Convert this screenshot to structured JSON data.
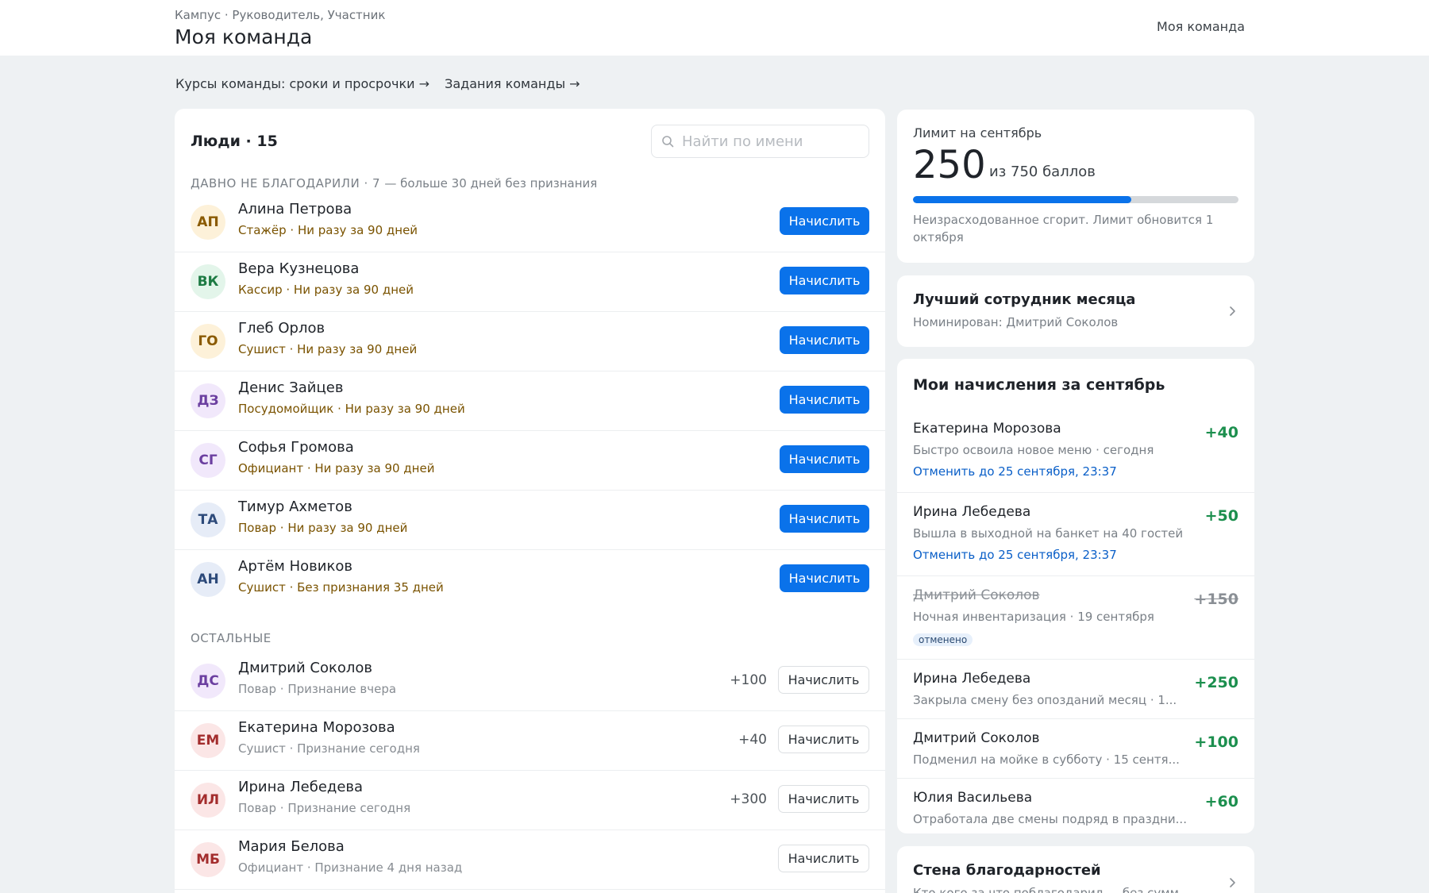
{
  "header": {
    "breadcrumb": "Кампус · Руководитель, Участник",
    "title": "Моя команда",
    "right_link": "Моя команда"
  },
  "links": [
    "Курсы команды: сроки и просрочки →",
    "Задания команды →"
  ],
  "people": {
    "heading": "Люди · 15",
    "search_placeholder": "Найти по имени",
    "stale_section": {
      "title": "ДАВНО НЕ БЛАГОДАРИЛИ · 7",
      "subtitle": "— больше 30 дней без признания"
    },
    "other_section_title": "ОСТАЛЬНЫЕ",
    "stale": [
      {
        "initials": "АП",
        "name": "Алина Петрова",
        "meta": "Стажёр · Ни разу за 90 дней",
        "action": "Начислить",
        "avatar_bg": "#fdf1d9",
        "avatar_fg": "#8a5a00"
      },
      {
        "initials": "ВК",
        "name": "Вера Кузнецова",
        "meta": "Кассир · Ни разу за 90 дней",
        "action": "Начислить",
        "avatar_bg": "#e3f5ea",
        "avatar_fg": "#1d7a43"
      },
      {
        "initials": "ГО",
        "name": "Глеб Орлов",
        "meta": "Сушист · Ни разу за 90 дней",
        "action": "Начислить",
        "avatar_bg": "#fdf1d9",
        "avatar_fg": "#8a5a00"
      },
      {
        "initials": "ДЗ",
        "name": "Денис Зайцев",
        "meta": "Посудомойщик · Ни разу за 90 дней",
        "action": "Начислить",
        "avatar_bg": "#f1e8fb",
        "avatar_fg": "#6b3fa0"
      },
      {
        "initials": "СГ",
        "name": "Софья Громова",
        "meta": "Официант · Ни разу за 90 дней",
        "action": "Начислить",
        "avatar_bg": "#f1e8fb",
        "avatar_fg": "#6b3fa0"
      },
      {
        "initials": "ТА",
        "name": "Тимур Ахметов",
        "meta": "Повар · Ни разу за 90 дней",
        "action": "Начислить",
        "avatar_bg": "#e6ecf7",
        "avatar_fg": "#2d4a7a"
      },
      {
        "initials": "АН",
        "name": "Артём Новиков",
        "meta": "Сушист · Без признания 35 дней",
        "action": "Начислить",
        "avatar_bg": "#e6ecf7",
        "avatar_fg": "#2d4a7a"
      }
    ],
    "others": [
      {
        "initials": "ДС",
        "name": "Дмитрий Соколов",
        "meta": "Повар · Признание вчера",
        "points": "+100",
        "action": "Начислить",
        "avatar_bg": "#f1e8fb",
        "avatar_fg": "#6b3fa0"
      },
      {
        "initials": "ЕМ",
        "name": "Екатерина Морозова",
        "meta": "Сушист · Признание сегодня",
        "points": "+40",
        "action": "Начислить",
        "avatar_bg": "#fbe6e6",
        "avatar_fg": "#a32d2d"
      },
      {
        "initials": "ИЛ",
        "name": "Ирина Лебедева",
        "meta": "Повар · Признание сегодня",
        "points": "+300",
        "action": "Начислить",
        "avatar_bg": "#fbe6e6",
        "avatar_fg": "#a32d2d"
      },
      {
        "initials": "МБ",
        "name": "Мария Белова",
        "meta": "Официант · Признание 4 дня назад",
        "points": "",
        "action": "Начислить",
        "avatar_bg": "#fbe6e6",
        "avatar_fg": "#a32d2d"
      }
    ]
  },
  "limit": {
    "label": "Лимит на сентябрь",
    "value": "250",
    "of_text": "из 750 баллов",
    "progress_fraction": 0.67,
    "note": "Неизрасходованное сгорит. Лимит обновится 1 октября"
  },
  "best_employee": {
    "title": "Лучший сотрудник месяца",
    "subtitle": "Номинирован: Дмитрий Соколов"
  },
  "my_grants": {
    "title": "Мои начисления за сентябрь",
    "items": [
      {
        "name": "Екатерина Морозова",
        "amount": "+40",
        "desc": "Быстро освоила новое меню · сегодня",
        "cancel": "Отменить до 25 сентября, 23:37",
        "cancelled": false
      },
      {
        "name": "Ирина Лебедева",
        "amount": "+50",
        "desc": "Вышла в выходной на банкет на 40 гостей",
        "cancel": "Отменить до 25 сентября, 23:37",
        "cancelled": false
      },
      {
        "name": "Дмитрий Соколов",
        "amount": "+150",
        "desc": "Ночная инвентаризация · 19 сентября",
        "badge": "отменено",
        "cancelled": true
      },
      {
        "name": "Ирина Лебедева",
        "amount": "+250",
        "desc": "Закрыла смену без опозданий месяц · 1...",
        "cancelled": false
      },
      {
        "name": "Дмитрий Соколов",
        "amount": "+100",
        "desc": "Подменил на мойке в субботу · 15 сентя...",
        "cancelled": false
      },
      {
        "name": "Юлия Васильева",
        "amount": "+60",
        "desc": "Отработала две смены подряд в праздни...",
        "cancelled": false
      }
    ]
  },
  "wall": {
    "title": "Стена благодарностей",
    "subtitle": "Кто кого за что поблагодарил — без сумм"
  },
  "colors": {
    "accent": "#0a72ea",
    "positive": "#1c8f4e",
    "warning_text": "#7a5300",
    "page_bg": "#eef1f3"
  }
}
